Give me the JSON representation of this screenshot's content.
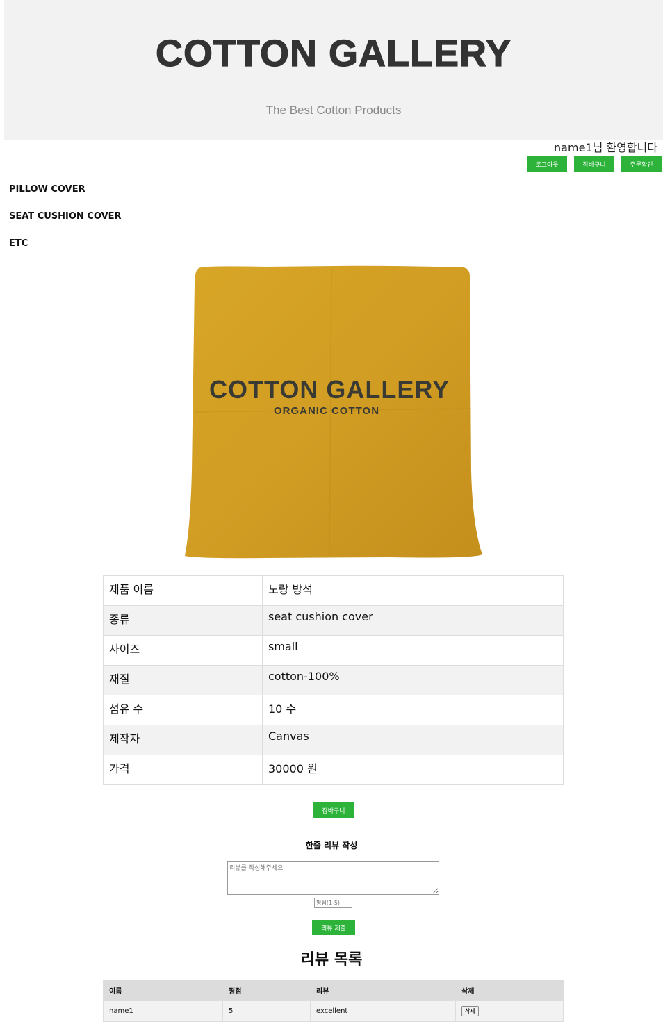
{
  "header": {
    "title": "COTTON GALLERY",
    "subtitle": "The Best Cotton Products"
  },
  "user": {
    "welcome": "name1님 환영합니다",
    "buttons": [
      "로그아웃",
      "장바구니",
      "주문확인"
    ]
  },
  "nav": {
    "items": [
      "PILLOW COVER",
      "SEAT CUSHION COVER",
      "ETC"
    ]
  },
  "product_image": {
    "brand_text": "COTTON GALLERY",
    "brand_subtext": "ORGANIC COTTON",
    "fabric_color": "#d19d23"
  },
  "details": [
    {
      "label": "제품 이름",
      "value": "노랑 방석"
    },
    {
      "label": "종류",
      "value": "seat cushion cover"
    },
    {
      "label": "사이즈",
      "value": "small"
    },
    {
      "label": "재질",
      "value": "cotton-100%"
    },
    {
      "label": "섬유 수",
      "value": "10 수"
    },
    {
      "label": "제작자",
      "value": "Canvas"
    },
    {
      "label": "가격",
      "value": "30000 원"
    }
  ],
  "actions": {
    "cart_label": "장바구니"
  },
  "review_form": {
    "heading": "한줄 리뷰 작성",
    "text_placeholder": "리뷰를 작성해주세요",
    "rating_placeholder": "평점(1-5)",
    "submit_label": "리뷰 제출"
  },
  "review_list": {
    "heading": "리뷰 목록",
    "columns": [
      "이름",
      "평점",
      "리뷰",
      "삭제"
    ],
    "rows": [
      {
        "name": "name1",
        "rating": "5",
        "review": "excellent",
        "delete_label": "삭제"
      }
    ]
  },
  "colors": {
    "accent_green": "#2db33a",
    "header_bg": "#f2f2f2"
  }
}
